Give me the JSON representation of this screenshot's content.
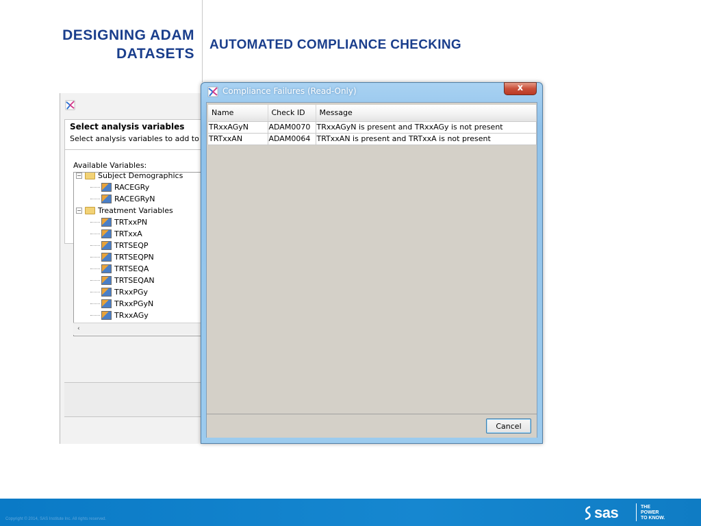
{
  "slide": {
    "title_line1": "DESIGNING ADAM",
    "title_line2": "DATASETS",
    "subtitle": "AUTOMATED COMPLIANCE CHECKING"
  },
  "wizard": {
    "heading": "Select analysis variables",
    "description": "Select analysis variables to add to th",
    "available_label": "Available Variables:",
    "tree": [
      {
        "type": "folder",
        "label": "Subject Demographics",
        "level": 0
      },
      {
        "type": "var",
        "label": "RACEGRy",
        "level": 1
      },
      {
        "type": "var",
        "label": "RACEGRyN",
        "level": 1
      },
      {
        "type": "folder",
        "label": "Treatment Variables",
        "level": 0
      },
      {
        "type": "var",
        "label": "TRTxxPN",
        "level": 1
      },
      {
        "type": "var",
        "label": "TRTxxA",
        "level": 1
      },
      {
        "type": "var",
        "label": "TRTSEQP",
        "level": 1
      },
      {
        "type": "var",
        "label": "TRTSEQPN",
        "level": 1
      },
      {
        "type": "var",
        "label": "TRTSEQA",
        "level": 1
      },
      {
        "type": "var",
        "label": "TRTSEQAN",
        "level": 1
      },
      {
        "type": "var",
        "label": "TRxxPGy",
        "level": 1
      },
      {
        "type": "var",
        "label": "TRxxPGyN",
        "level": 1
      },
      {
        "type": "var",
        "label": "TRxxAGy",
        "level": 1
      }
    ],
    "scroll_left": "‹"
  },
  "dialog": {
    "title": "Compliance Failures (Read-Only)",
    "close_label": "x",
    "columns": [
      "Name",
      "Check ID",
      "Message"
    ],
    "rows": [
      [
        "TRxxAGyN",
        "ADAM0070",
        "TRxxAGyN is present and TRxxAGy is not present"
      ],
      [
        "TRTxxAN",
        "ADAM0064",
        "TRTxxAN is present and TRTxxA is not present"
      ]
    ],
    "cancel_label": "Cancel"
  },
  "footer": {
    "copyright": "Copyright © 2014, SAS Institute Inc. All rights reserved.",
    "logo_text": "sas",
    "tagline": [
      "THE",
      "POWER",
      "TO KNOW."
    ]
  },
  "colors": {
    "title_blue": "#1a3e8c",
    "footer_blue": "#1687d0",
    "dialog_frame": "#9ccbee"
  }
}
